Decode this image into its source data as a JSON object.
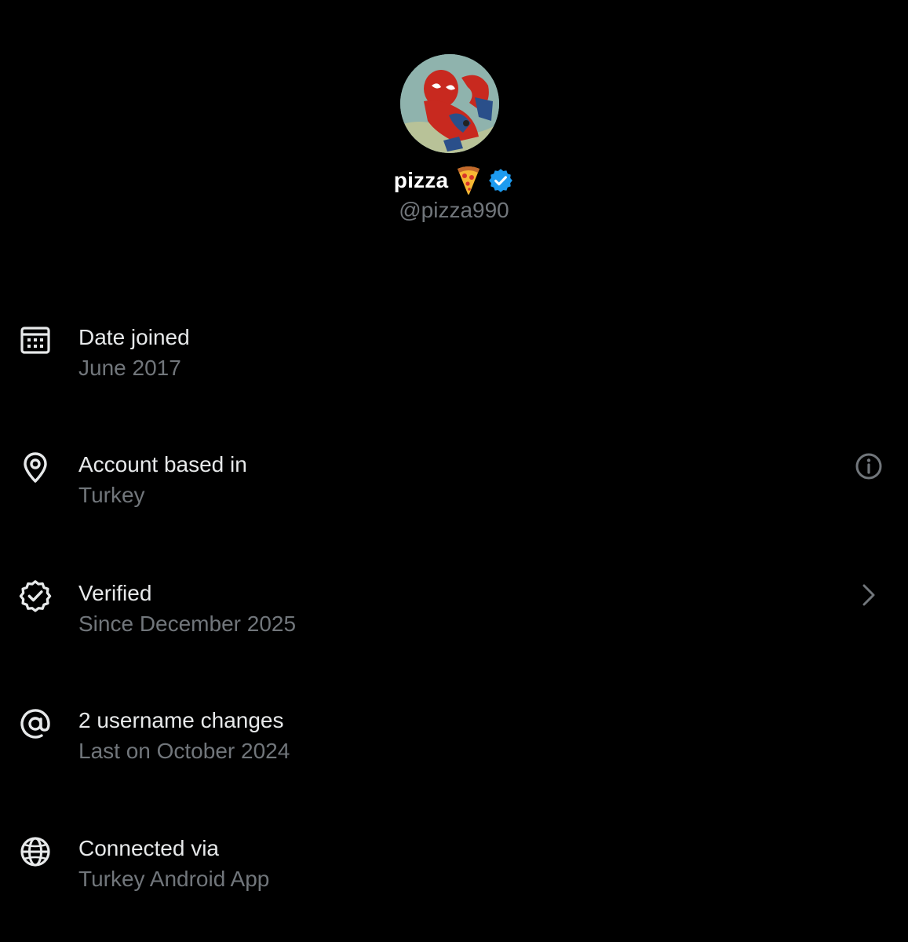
{
  "profile": {
    "display_name": "pizza",
    "name_emoji": "pizza-emoji",
    "verified_badge": "verified-badge-icon",
    "handle": "@pizza990",
    "accent_color": "#1d9bf0"
  },
  "info_rows": [
    {
      "icon": "calendar-icon",
      "title": "Date joined",
      "subtitle": "June 2017"
    },
    {
      "icon": "location-pin-icon",
      "title": "Account based in",
      "subtitle": "Turkey",
      "trailing_icon": "info-icon"
    },
    {
      "icon": "verified-check-icon",
      "title": "Verified",
      "subtitle": "Since December 2025",
      "trailing_icon": "chevron-right-icon"
    },
    {
      "icon": "at-sign-icon",
      "title": "2 username changes",
      "subtitle": "Last on October 2024"
    },
    {
      "icon": "globe-icon",
      "title": "Connected via",
      "subtitle": "Turkey Android App"
    }
  ],
  "colors": {
    "background": "#000000",
    "primary_text": "#e7e9ea",
    "secondary_text": "#71767b",
    "icon": "#e7e9ea"
  }
}
